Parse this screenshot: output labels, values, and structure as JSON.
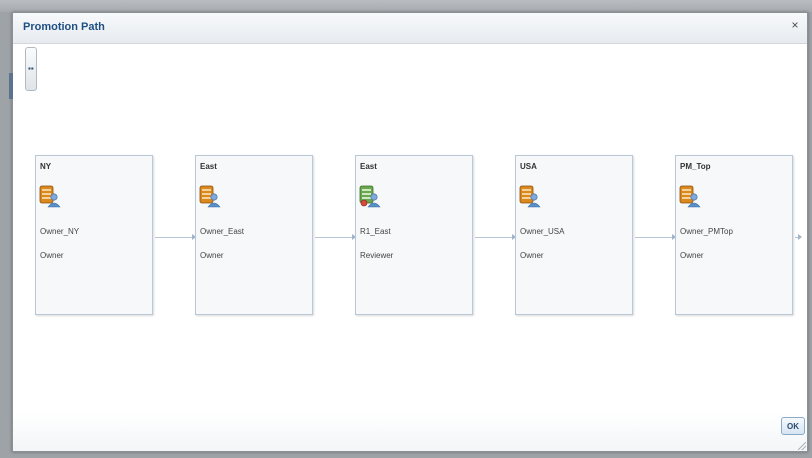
{
  "dialog": {
    "title": "Promotion Path",
    "close_label": "×",
    "ok_label": "OK"
  },
  "nodes": [
    {
      "title": "NY",
      "user": "Owner_NY",
      "role": "Owner",
      "icon": "database-owner-icon"
    },
    {
      "title": "East",
      "user": "Owner_East",
      "role": "Owner",
      "icon": "database-owner-icon"
    },
    {
      "title": "East",
      "user": "R1_East",
      "role": "Reviewer",
      "icon": "database-reviewer-icon"
    },
    {
      "title": "USA",
      "user": "Owner_USA",
      "role": "Owner",
      "icon": "database-owner-icon"
    },
    {
      "title": "PM_Top",
      "user": "Owner_PMTop",
      "role": "Owner",
      "icon": "database-owner-icon"
    }
  ],
  "colors": {
    "title": "#1f4f82",
    "card_border": "#b9c7d6",
    "connector": "#b6c6d8"
  }
}
